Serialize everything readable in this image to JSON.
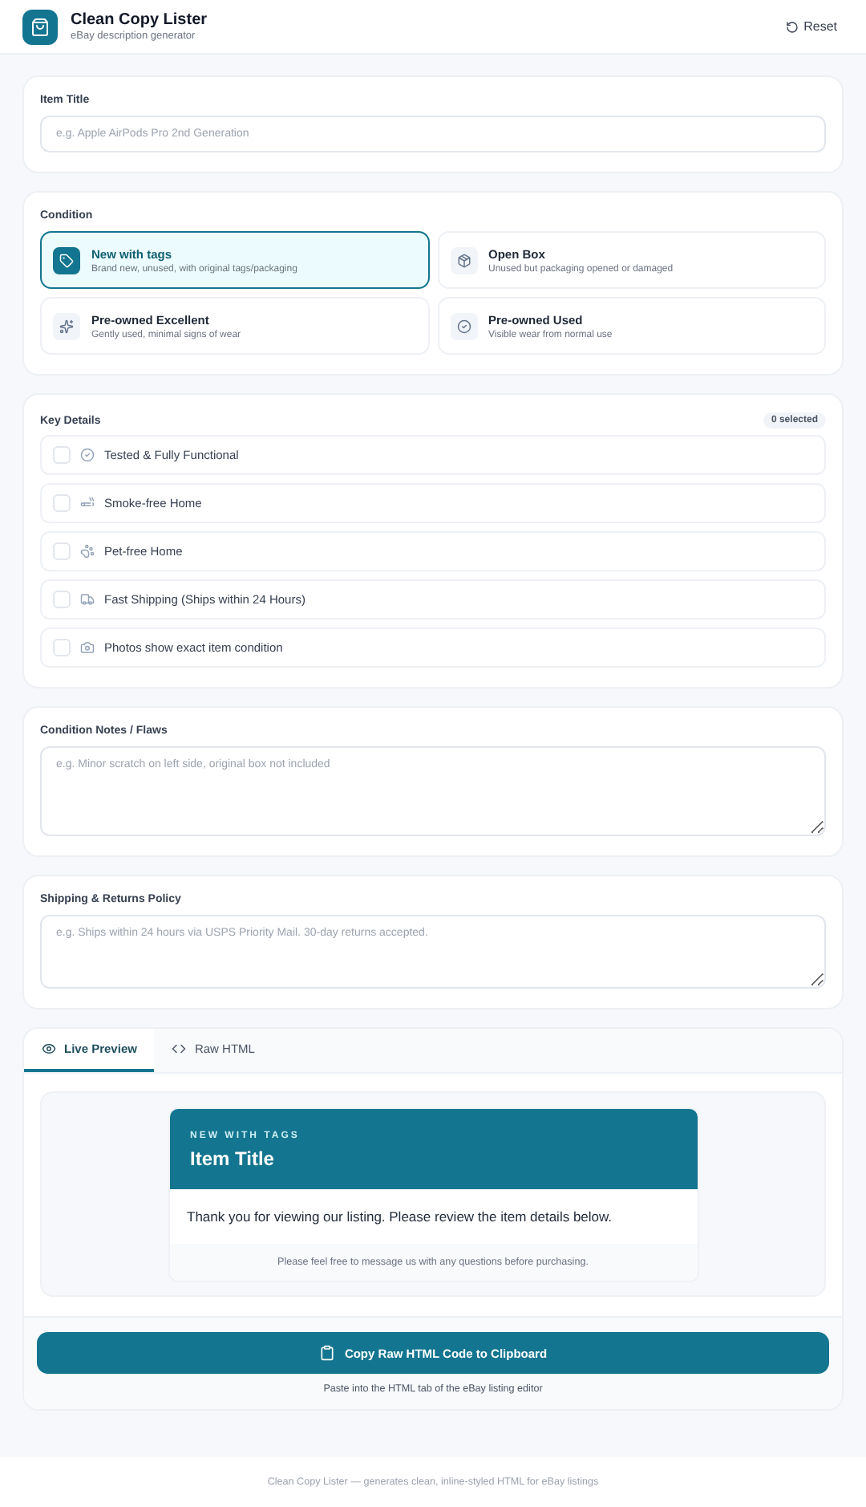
{
  "header": {
    "title": "Clean Copy Lister",
    "subtitle": "eBay description generator",
    "reset": "Reset"
  },
  "item_title": {
    "label": "Item Title",
    "placeholder": "e.g. Apple AirPods Pro 2nd Generation"
  },
  "condition": {
    "label": "Condition",
    "options": [
      {
        "kind": "tag",
        "title": "New with tags",
        "description": "Brand new, unused, with original tags/packaging",
        "selected": true
      },
      {
        "kind": "box",
        "title": "Open Box",
        "description": "Unused but packaging opened or damaged",
        "selected": false
      },
      {
        "kind": "sparkle",
        "title": "Pre-owned Excellent",
        "description": "Gently used, minimal signs of wear",
        "selected": false
      },
      {
        "kind": "check",
        "title": "Pre-owned Used",
        "description": "Visible wear from normal use",
        "selected": false
      }
    ]
  },
  "key_details": {
    "label": "Key Details",
    "count": "0 selected",
    "items": [
      {
        "kind": "check",
        "label": "Tested & Fully Functional",
        "checked": false
      },
      {
        "kind": "smoke",
        "label": "Smoke-free Home",
        "checked": false
      },
      {
        "kind": "pet",
        "label": "Pet-free Home",
        "checked": false
      },
      {
        "kind": "truck",
        "label": "Fast Shipping (Ships within 24 Hours)",
        "checked": false
      },
      {
        "kind": "camera",
        "label": "Photos show exact item condition",
        "checked": false
      }
    ]
  },
  "notes": {
    "label": "Condition Notes / Flaws",
    "placeholder": "e.g. Minor scratch on left side, original box not included"
  },
  "shipping": {
    "label": "Shipping & Returns Policy",
    "placeholder": "e.g. Ships within 24 hours via USPS Priority Mail. 30-day returns accepted."
  },
  "output": {
    "tabs": [
      {
        "kind": "preview",
        "label": "Live Preview",
        "selected": true
      },
      {
        "kind": "code",
        "label": "Raw HTML",
        "selected": false
      }
    ],
    "preview": {
      "condition": "NEW WITH TAGS",
      "title": "Item Title",
      "intro": "Thank you for viewing our listing. Please review the item details below.",
      "footer": "Please feel free to message us with any questions before purchasing."
    },
    "copy_button": "Copy Raw HTML Code to Clipboard",
    "hint": "Paste into the HTML tab of the eBay listing editor"
  },
  "footer": "Clean Copy Lister — generates clean, inline-styled HTML for eBay listings"
}
